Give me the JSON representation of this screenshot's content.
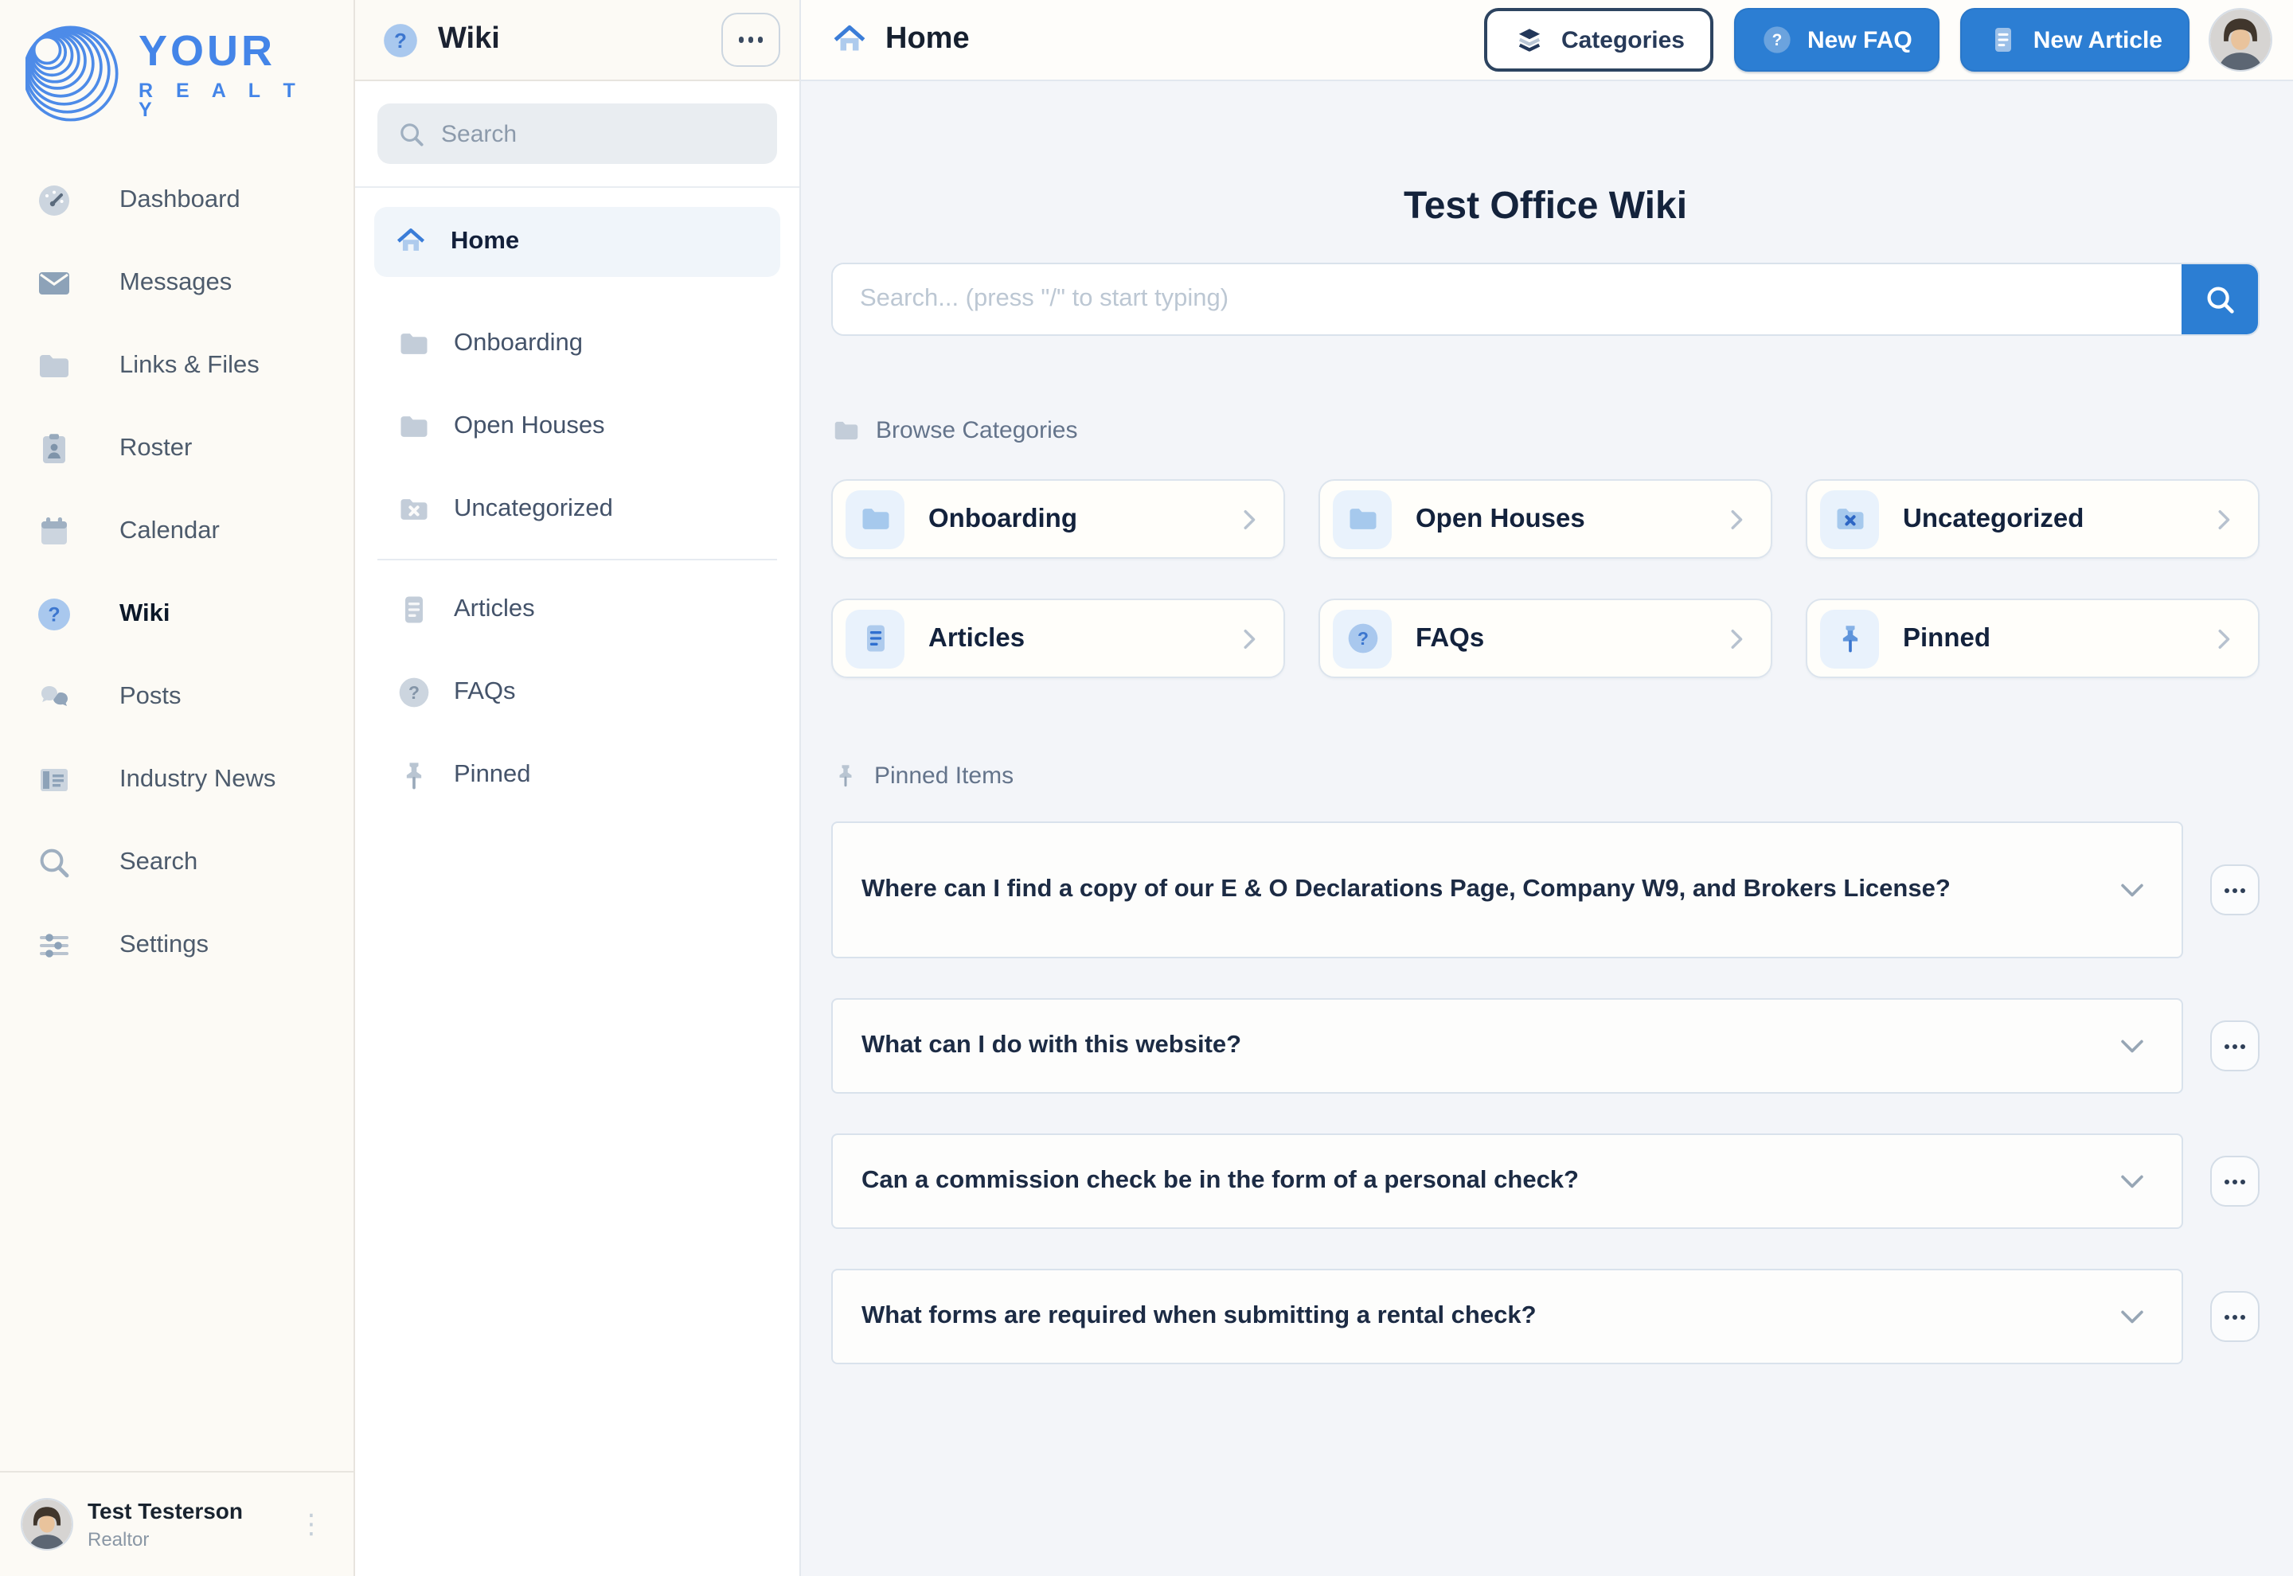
{
  "brand": {
    "line1": "YOUR",
    "line2": "R E A L T Y"
  },
  "sidebar": {
    "items": [
      {
        "label": "Dashboard"
      },
      {
        "label": "Messages"
      },
      {
        "label": "Links & Files"
      },
      {
        "label": "Roster"
      },
      {
        "label": "Calendar"
      },
      {
        "label": "Wiki"
      },
      {
        "label": "Posts"
      },
      {
        "label": "Industry News"
      },
      {
        "label": "Search"
      },
      {
        "label": "Settings"
      }
    ],
    "user": {
      "name": "Test Testerson",
      "role": "Realtor"
    }
  },
  "wiki_panel": {
    "title": "Wiki",
    "search_placeholder": "Search",
    "items": [
      {
        "label": "Home"
      },
      {
        "label": "Onboarding"
      },
      {
        "label": "Open Houses"
      },
      {
        "label": "Uncategorized"
      },
      {
        "label": "Articles"
      },
      {
        "label": "FAQs"
      },
      {
        "label": "Pinned"
      }
    ]
  },
  "main": {
    "header": {
      "title": "Home",
      "categories_button": "Categories",
      "new_faq_button": "New FAQ",
      "new_article_button": "New Article"
    },
    "page_title": "Test Office Wiki",
    "search_placeholder": "Search... (press \"/\" to start typing)",
    "browse_section_label": "Browse Categories",
    "categories": [
      {
        "label": "Onboarding"
      },
      {
        "label": "Open Houses"
      },
      {
        "label": "Uncategorized"
      },
      {
        "label": "Articles"
      },
      {
        "label": "FAQs"
      },
      {
        "label": "Pinned"
      }
    ],
    "pinned_section_label": "Pinned Items",
    "pinned_items": [
      {
        "question": "Where can I find a copy of our E & O Declarations Page, Company W9, and Brokers License?"
      },
      {
        "question": "What can I do with this website?"
      },
      {
        "question": "Can a commission check be in the form of a personal check?"
      },
      {
        "question": "What forms are required when submitting a rental check?"
      }
    ]
  },
  "colors": {
    "brand_blue": "#4485e8",
    "accent_blue": "#2c7ed3",
    "content_bg": "#f3f5f9",
    "cream_bg": "#fcfaf5"
  }
}
